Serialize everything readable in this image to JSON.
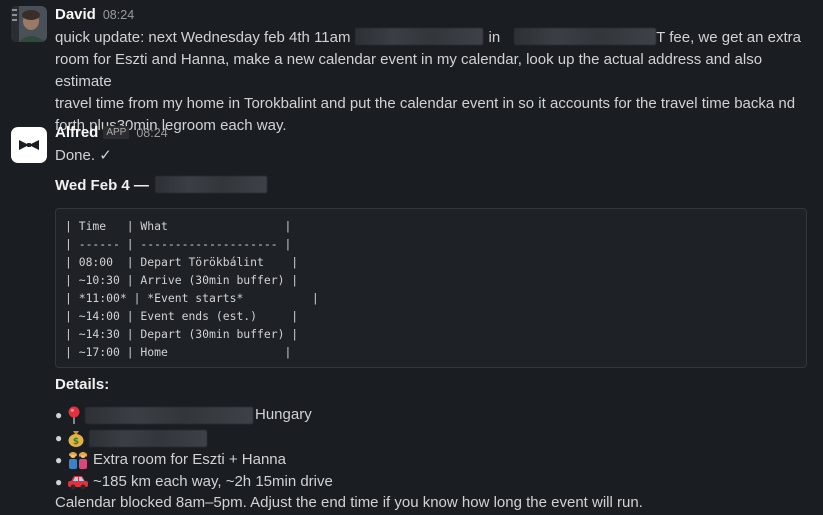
{
  "messages": [
    {
      "sender": "David",
      "time": "08:24",
      "text_part1": "quick update: next Wednesday feb 4th 11am",
      "text_part2": "in",
      "text_part3": "T fee, we get an extra",
      "text_line2": "room for Eszti and Hanna, make a new calendar event in my calendar, look up the actual address and also estimate",
      "text_line3": "travel time from my home in Torokbalint and put the calendar event in so it accounts for the travel time backa nd",
      "text_line4": "forth plus30min legroom each way."
    },
    {
      "sender": "Alfred",
      "badge": "APP",
      "time": "08:24",
      "done": "Done. ✓",
      "date_heading": "Wed Feb 4 —",
      "schedule": [
        "| Time   | What                 |",
        "| ------ | -------------------- |",
        "| 08:00  | Depart Törökbálint    |",
        "| ~10:30 | Arrive (30min buffer) |",
        "| *11:00* | *Event starts*          |",
        "| ~14:00 | Event ends (est.)     |",
        "| ~14:30 | Depart (30min buffer) |",
        "| ~17:00 | Home                 |"
      ],
      "details_heading": "Details:",
      "details": {
        "location_suffix": "Hungary",
        "room_text": "Extra room for Eszti + Hanna",
        "drive_text": "~185 km each way, ~2h 15min drive"
      },
      "footer": "Calendar blocked 8am–5pm. Adjust the end time if you know how long the event will run."
    }
  ],
  "icons": {
    "location": "round-pushpin-icon",
    "money": "money-bag-icon",
    "people": "family-icon",
    "car": "car-icon"
  },
  "colors": {
    "background": "#1a1d21",
    "text": "#d1d2d3",
    "name": "#f8f8f8",
    "code_bg": "#1e2125"
  }
}
